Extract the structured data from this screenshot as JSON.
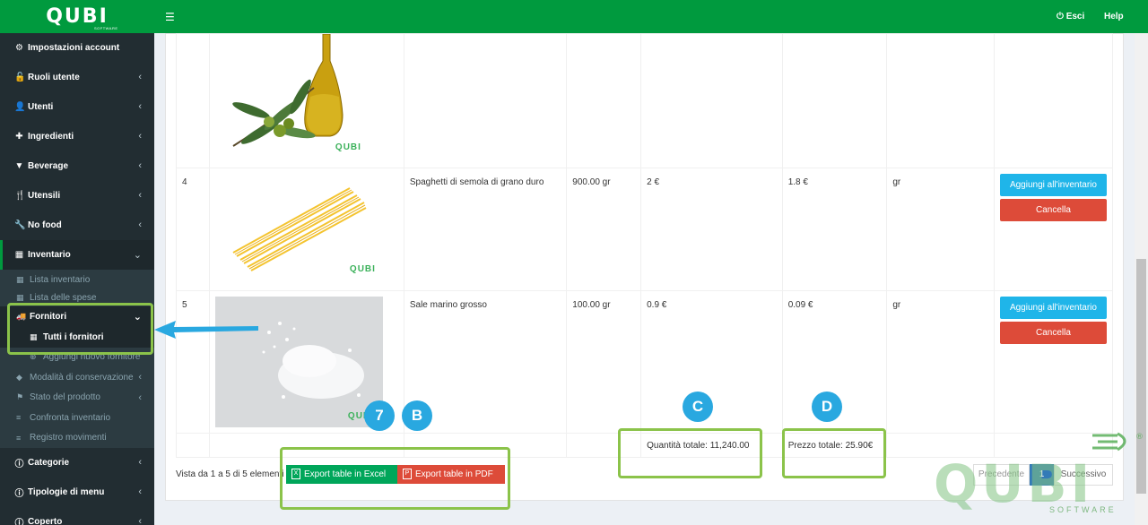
{
  "app": {
    "logo": "QUBI",
    "logo_sub": "SOFTWARE"
  },
  "header": {
    "logout": "Esci",
    "help": "Help"
  },
  "sidebar": {
    "items": [
      {
        "label": "Impostazioni account"
      },
      {
        "label": "Ruoli utente"
      },
      {
        "label": "Utenti"
      },
      {
        "label": "Ingredienti"
      },
      {
        "label": "Beverage"
      },
      {
        "label": "Utensili"
      },
      {
        "label": "No food"
      },
      {
        "label": "Inventario"
      }
    ],
    "sub": {
      "lista_inventario": "Lista inventario",
      "lista_spese": "Lista delle spese",
      "fornitori": "Fornitori",
      "tutti_fornitori": "Tutti i fornitori",
      "aggiungi_fornitore": "Aggiungi nuovo fornitore",
      "modalita": "Modalità di conservazione",
      "stato": "Stato del prodotto",
      "confronta": "Confronta inventario",
      "registro": "Registro movimenti"
    },
    "bottom": [
      {
        "label": "Categorie"
      },
      {
        "label": "Tipologie di menu"
      },
      {
        "label": "Coperto"
      }
    ]
  },
  "table": {
    "rows": [
      {
        "num": "4",
        "name": "Spaghetti di semola di grano duro",
        "qty": "900.00 gr",
        "price": "2 €",
        "total": "1.8 €",
        "unit": "gr",
        "add": "Aggiungi all'inventario",
        "delete": "Cancella"
      },
      {
        "num": "5",
        "name": "Sale marino grosso",
        "qty": "100.00 gr",
        "price": "0.9 €",
        "total": "0.09 €",
        "unit": "gr",
        "add": "Aggiungi all'inventario",
        "delete": "Cancella"
      }
    ],
    "qty_total": "Quantità totale: 11,240.00",
    "price_total": "Prezzo totale: 25.90€",
    "image_watermark": "QUBI"
  },
  "footer": {
    "info": "Vista da 1 a 5 di 5 elementi",
    "excel": "Export table in Excel",
    "pdf": "Export table in PDF",
    "prev": "Precedente",
    "page": "1",
    "next": "Successivo"
  },
  "annotations": {
    "c7": "7",
    "cB": "B",
    "cC": "C",
    "cD": "D"
  },
  "watermark": {
    "text": "QUBI",
    "sub": "SOFTWARE"
  },
  "colors": {
    "brand_green": "#009a3e",
    "sidebar": "#222d32",
    "blue": "#1fb5e9",
    "red": "#dd4b39",
    "highlight": "#8bc34a",
    "annotation_blue": "#29a8e0"
  }
}
